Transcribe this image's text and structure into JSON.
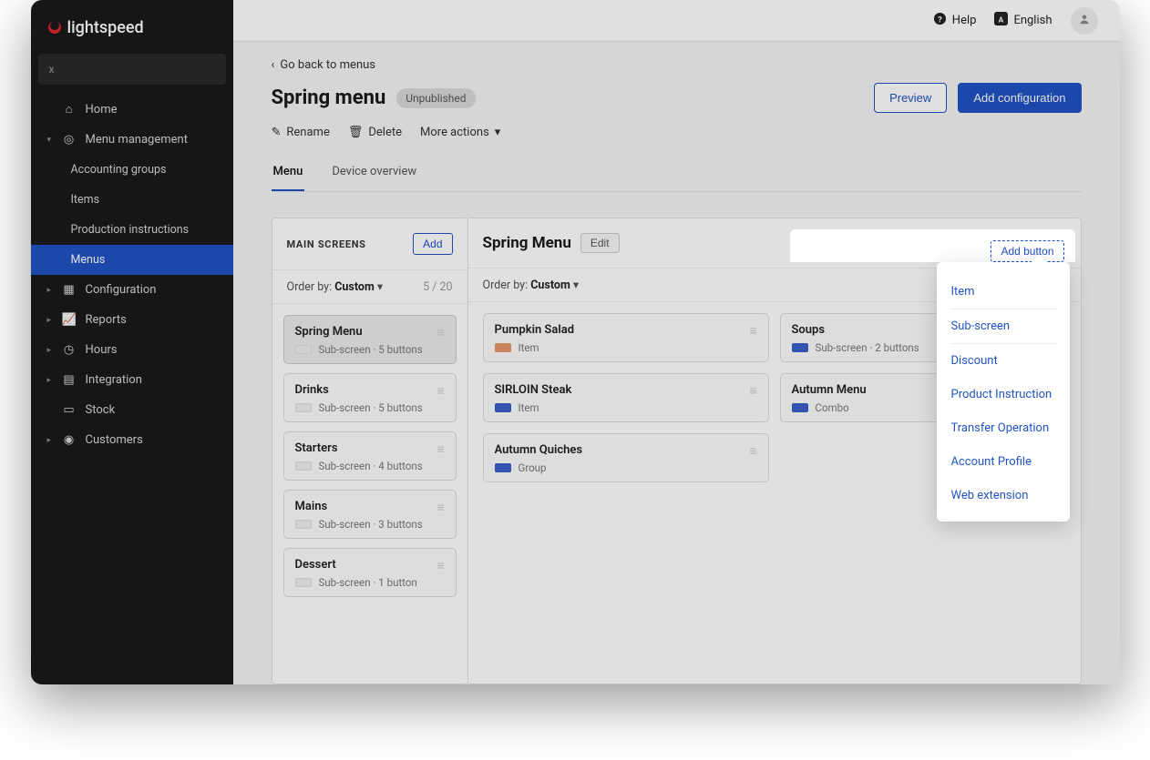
{
  "brand": "lightspeed",
  "sidebar": {
    "collapse": "x",
    "items": [
      {
        "label": "Home"
      },
      {
        "label": "Menu management",
        "expanded": true,
        "children": [
          {
            "label": "Accounting groups"
          },
          {
            "label": "Items"
          },
          {
            "label": "Production instructions"
          },
          {
            "label": "Menus",
            "active": true
          }
        ]
      },
      {
        "label": "Configuration"
      },
      {
        "label": "Reports"
      },
      {
        "label": "Hours"
      },
      {
        "label": "Integration"
      },
      {
        "label": "Stock"
      },
      {
        "label": "Customers"
      }
    ]
  },
  "topbar": {
    "help": "Help",
    "language": "English"
  },
  "page": {
    "back": "Go back to menus",
    "title": "Spring menu",
    "status": "Unpublished",
    "actions": {
      "rename": "Rename",
      "delete": "Delete",
      "more": "More actions"
    },
    "preview": "Preview",
    "add_config": "Add configuration",
    "tabs": {
      "menu": "Menu",
      "device": "Device overview"
    }
  },
  "screens": {
    "heading": "MAIN SCREENS",
    "add": "Add",
    "order_by_label": "Order by:",
    "order_by_value": "Custom",
    "count": "5 / 20",
    "items": [
      {
        "title": "Spring Menu",
        "meta": "Sub-screen · 5 buttons",
        "selected": true
      },
      {
        "title": "Drinks",
        "meta": "Sub-screen · 5 buttons"
      },
      {
        "title": "Starters",
        "meta": "Sub-screen · 4 buttons"
      },
      {
        "title": "Mains",
        "meta": "Sub-screen · 3 buttons"
      },
      {
        "title": "Dessert",
        "meta": "Sub-screen · 1 button"
      }
    ]
  },
  "detail": {
    "title": "Spring Menu",
    "edit": "Edit",
    "add_button": "Add button",
    "order_by_label": "Order by:",
    "order_by_value": "Custom",
    "cards": [
      {
        "title": "Pumpkin Salad",
        "meta": "Item",
        "swatch": "orange"
      },
      {
        "title": "Soups",
        "meta": "Sub-screen · 2 buttons",
        "swatch": "blue"
      },
      {
        "title": "SIRLOIN Steak",
        "meta": "Item",
        "swatch": "blue"
      },
      {
        "title": "Autumn Menu",
        "meta": "Combo",
        "swatch": "blue"
      },
      {
        "title": "Autumn Quiches",
        "meta": "Group",
        "swatch": "blue"
      }
    ]
  },
  "dropdown": {
    "items": [
      "Item",
      "Sub-screen",
      "Discount",
      "Product Instruction",
      "Transfer Operation",
      "Account Profile",
      "Web extension"
    ]
  }
}
